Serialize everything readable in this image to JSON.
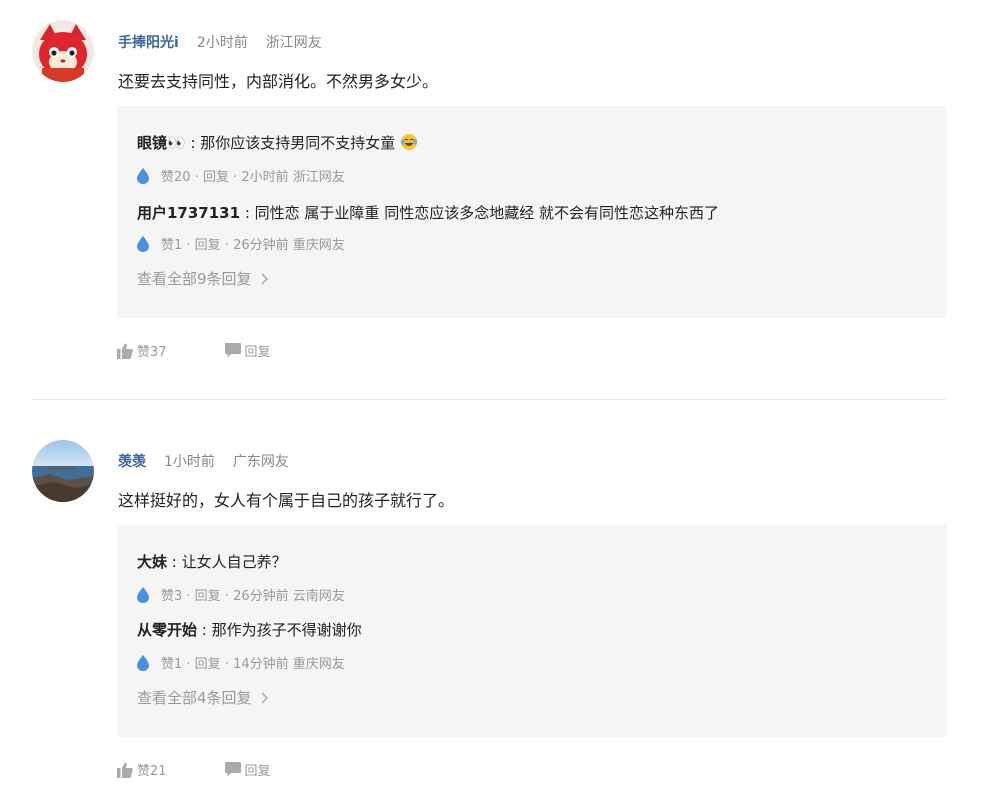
{
  "comments": [
    {
      "username": "手捧阳光i",
      "time": "2小时前",
      "location": "浙江网友",
      "text": "还要去支持同性，内部消化。不然男多女少。",
      "replies": [
        {
          "name": "眼镜👀",
          "sep": " : ",
          "text": "那你应该支持男同不支持女童",
          "emoji": "tears-of-joy-emoji",
          "meta": "赞20 · 回复 · 2小时前 浙江网友"
        },
        {
          "name": "用户1737131",
          "sep": " : ",
          "text": "同性恋 属于业障重 同性恋应该多念地藏经 就不会有同性恋这种东西了",
          "meta": "赞1 · 回复 · 26分钟前 重庆网友"
        }
      ],
      "view_all": "查看全部9条回复",
      "likes": "赞37",
      "reply_label": "回复"
    },
    {
      "username": "羡羡",
      "time": "1小时前",
      "location": "广东网友",
      "text": "这样挺好的，女人有个属于自己的孩子就行了。",
      "replies": [
        {
          "name": "大妹",
          "sep": " : ",
          "text": "让女人自己养？",
          "meta": "赞3 · 回复 · 26分钟前 云南网友"
        },
        {
          "name": "从零开始",
          "sep": " : ",
          "text": "那作为孩子不得谢谢你",
          "meta": "赞1 · 回复 · 14分钟前 重庆网友"
        }
      ],
      "view_all": "查看全部4条回复",
      "likes": "赞21",
      "reply_label": "回复"
    }
  ],
  "colors": {
    "username": "#406599",
    "reply_box_bg": "#f5f5f5",
    "meta_text": "#999999",
    "drop_icon": "#4a8fe0"
  },
  "icons": {
    "reply_like": "water-drop-icon",
    "like": "thumbs-up-icon",
    "reply": "speech-bubble-icon",
    "view_all": "chevron-right-icon"
  }
}
